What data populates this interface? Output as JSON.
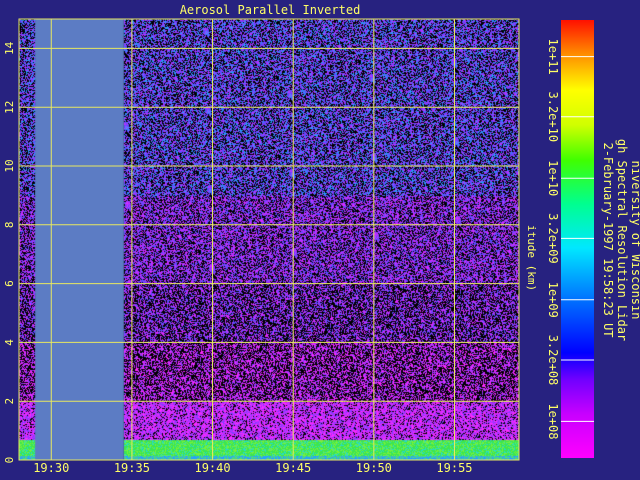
{
  "colors": {
    "background": "#272280",
    "text": "#ffff66",
    "grid": "#e8e860",
    "nodata": "#5c7cc4"
  },
  "chart_data": {
    "type": "heatmap",
    "title": "Aerosol Parallel Inverted",
    "ylabel": "itude (km)",
    "ylim": [
      0,
      15
    ],
    "yticks": [
      "0",
      "2",
      "4",
      "6",
      "8",
      "10",
      "12",
      "14"
    ],
    "y_tick_values": [
      0,
      2,
      4,
      6,
      8,
      10,
      12,
      14
    ],
    "xlim": [
      "19:28",
      "19:59"
    ],
    "xticks": [
      "19:30",
      "19:35",
      "19:40",
      "19:45",
      "19:50",
      "19:55"
    ],
    "x_tick_values": [
      "19:30",
      "19:35",
      "19:40",
      "19:45",
      "19:50",
      "19:55"
    ],
    "grid": true,
    "nodata_interval": [
      "19:29",
      "19:34.5"
    ],
    "colorbar": {
      "ticks": [
        "1e+08",
        "3.2e+08",
        "1e+09",
        "3.2e+09",
        "1e+10",
        "3.2e+10",
        "1e+11"
      ],
      "tick_values": [
        100000000.0,
        320000000.0,
        1000000000.0,
        3200000000.0,
        10000000000.0,
        32000000000.0,
        100000000000.0
      ],
      "range": [
        50000000.0,
        200000000000.0
      ],
      "scale": "log"
    }
  },
  "caption": {
    "line1": "niversity of Wisconsin",
    "line2": "gh Spectral Resolution Lidar",
    "line3": "2-February-1997 19:58:23 UT"
  }
}
